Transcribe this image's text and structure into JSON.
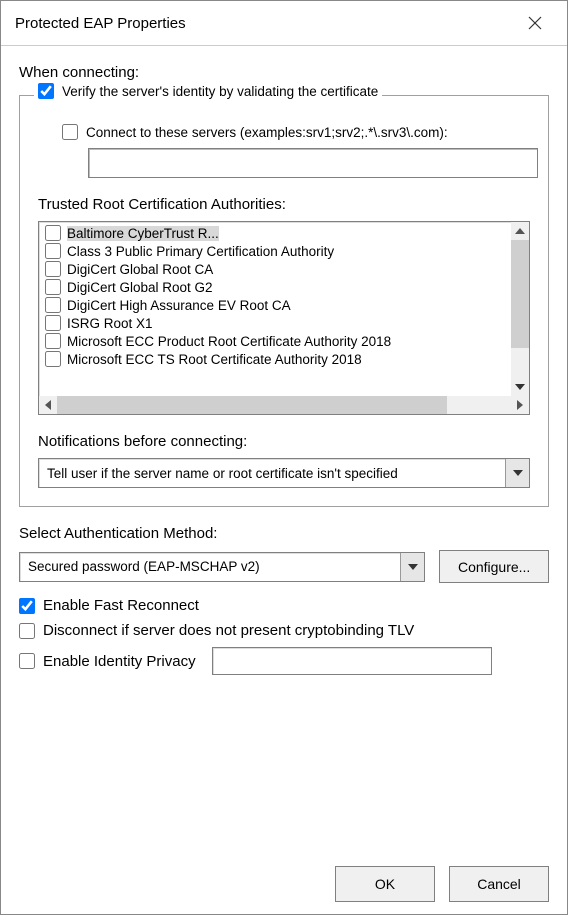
{
  "window": {
    "title": "Protected EAP Properties"
  },
  "connect": {
    "heading": "When connecting:",
    "verify_label": "Verify the server's identity by validating the certificate",
    "verify_checked": true,
    "servers_label": "Connect to these servers (examples:srv1;srv2;.*\\.srv3\\.com):",
    "servers_checked": false,
    "servers_value": ""
  },
  "trusted": {
    "heading": "Trusted Root Certification Authorities:",
    "items": [
      {
        "label": "Baltimore CyberTrust R...",
        "checked": false,
        "selected": true
      },
      {
        "label": "Class 3 Public Primary Certification Authority",
        "checked": false,
        "selected": false
      },
      {
        "label": "DigiCert Global Root CA",
        "checked": false,
        "selected": false
      },
      {
        "label": "DigiCert Global Root G2",
        "checked": false,
        "selected": false
      },
      {
        "label": "DigiCert High Assurance EV Root CA",
        "checked": false,
        "selected": false
      },
      {
        "label": "ISRG Root X1",
        "checked": false,
        "selected": false
      },
      {
        "label": "Microsoft ECC Product Root Certificate Authority 2018",
        "checked": false,
        "selected": false
      },
      {
        "label": "Microsoft ECC TS Root Certificate Authority 2018",
        "checked": false,
        "selected": false
      }
    ]
  },
  "notifications": {
    "heading": "Notifications before connecting:",
    "selected": "Tell user if the server name or root certificate isn't specified"
  },
  "auth": {
    "heading": "Select Authentication Method:",
    "selected": "Secured password (EAP-MSCHAP v2)",
    "configure_label": "Configure..."
  },
  "options": {
    "fast_reconnect": {
      "label": "Enable Fast Reconnect",
      "checked": true
    },
    "cryptobinding": {
      "label": "Disconnect if server does not present cryptobinding TLV",
      "checked": false
    },
    "identity_privacy": {
      "label": "Enable Identity Privacy",
      "checked": false,
      "value": ""
    }
  },
  "footer": {
    "ok": "OK",
    "cancel": "Cancel"
  }
}
